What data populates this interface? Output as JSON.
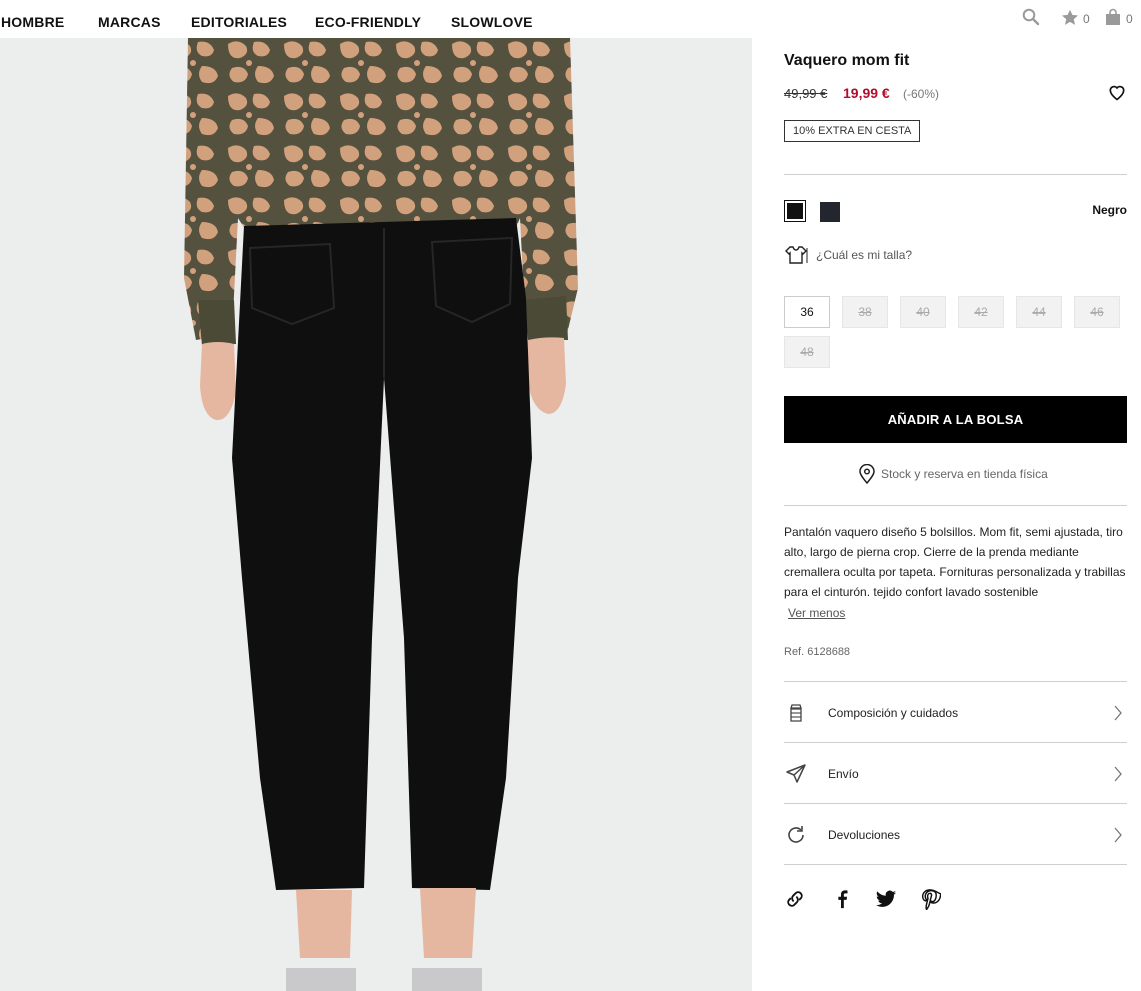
{
  "nav": {
    "items": [
      "HOMBRE",
      "MARCAS",
      "EDITORIALES",
      "ECO-FRIENDLY",
      "SLOWLOVE"
    ],
    "wishlist_count": "0",
    "bag_count": "0"
  },
  "product": {
    "title": "Vaquero mom fit",
    "price_old": "49,99 €",
    "price_new": "19,99 €",
    "discount": "(-60%)",
    "extra_badge": "10% EXTRA EN CESTA",
    "color_selected": "Negro",
    "colors": [
      "#111111",
      "#23252f"
    ],
    "size_guide": "¿Cuál es mi talla?",
    "sizes": [
      {
        "label": "36",
        "available": true
      },
      {
        "label": "38",
        "available": false
      },
      {
        "label": "40",
        "available": false
      },
      {
        "label": "42",
        "available": false
      },
      {
        "label": "44",
        "available": false
      },
      {
        "label": "46",
        "available": false
      },
      {
        "label": "48",
        "available": false
      }
    ],
    "add_to_bag": "AÑADIR A LA BOLSA",
    "stock_link": "Stock y reserva en tienda física",
    "description": "Pantalón vaquero diseño 5 bolsillos. Mom fit, semi ajustada, tiro alto, largo de pierna crop. Cierre de la prenda mediante cremallera oculta por tapeta. Fornituras personalizada y trabillas para el cinturón. tejido confort lavado sostenible",
    "see_less": "Ver menos",
    "ref": "Ref. 6128688",
    "accordions": [
      "Composición y cuidados",
      "Envío",
      "Devoluciones"
    ]
  }
}
